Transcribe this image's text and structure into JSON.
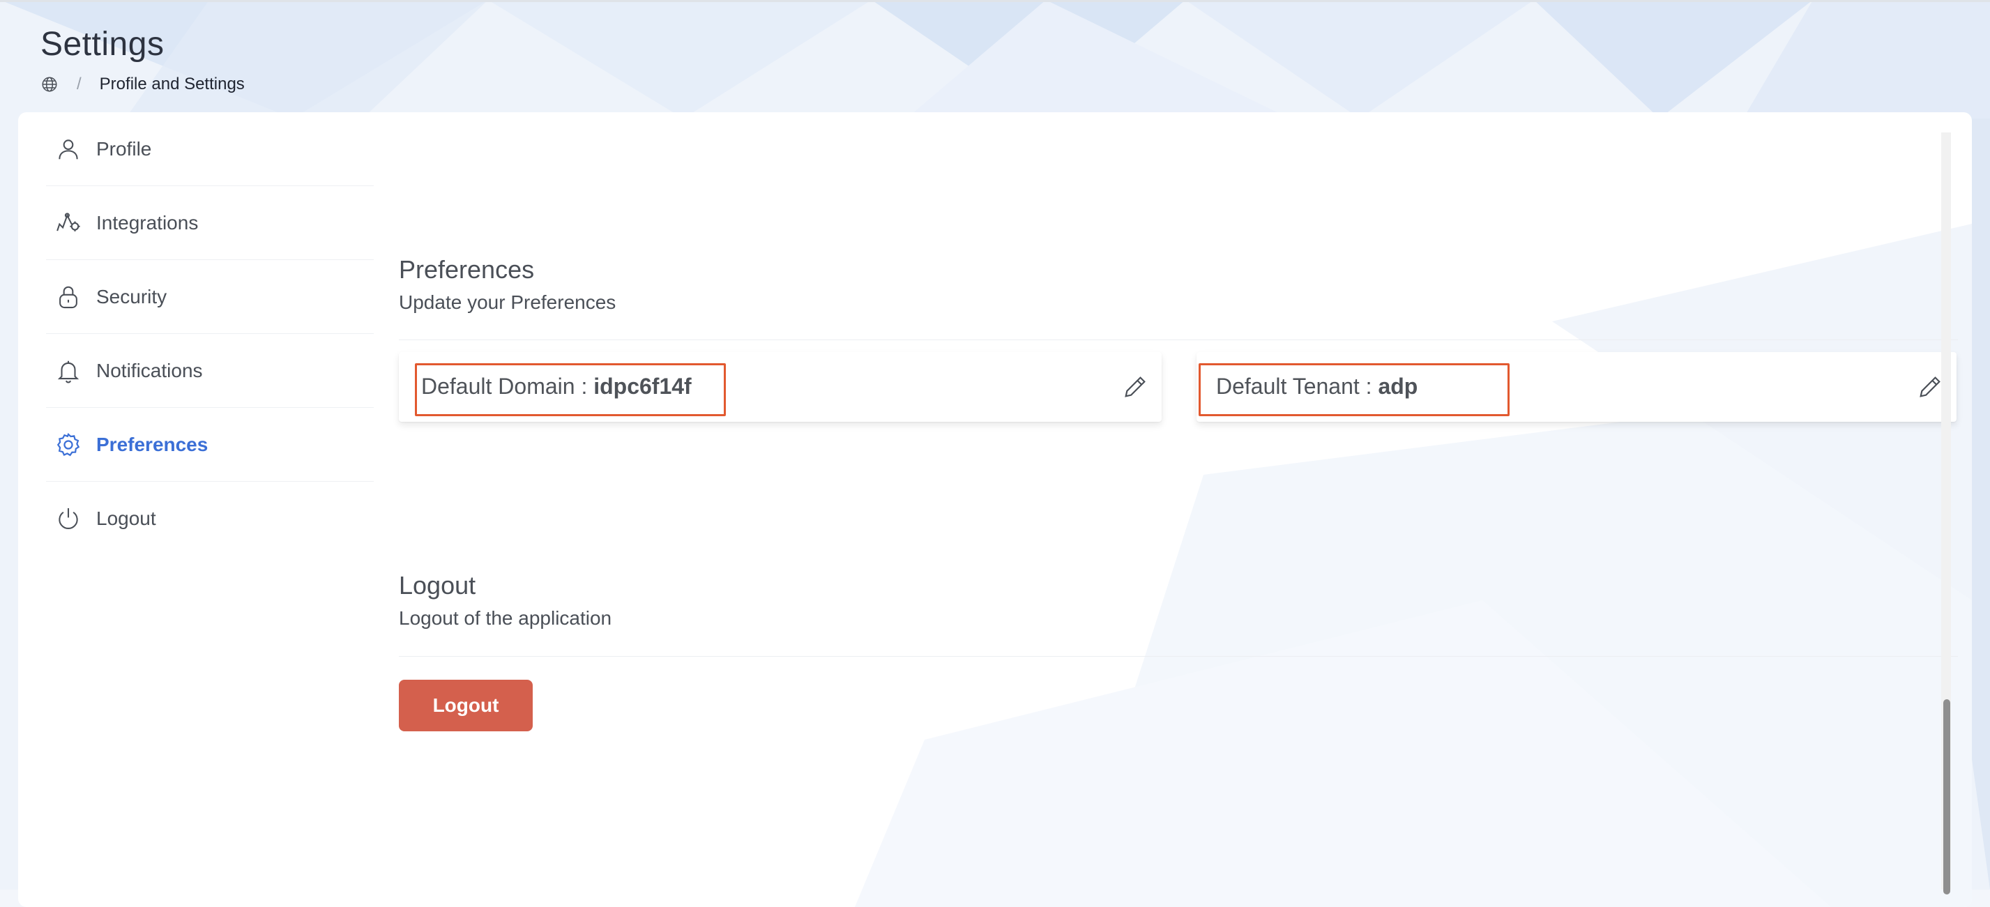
{
  "page": {
    "title": "Settings"
  },
  "breadcrumb": {
    "icon": "globe-icon",
    "separator": "/",
    "current": "Profile and Settings"
  },
  "sidebar": {
    "items": [
      {
        "label": "Profile",
        "icon": "user-icon",
        "active": false
      },
      {
        "label": "Integrations",
        "icon": "integrations-icon",
        "active": false
      },
      {
        "label": "Security",
        "icon": "lock-icon",
        "active": false
      },
      {
        "label": "Notifications",
        "icon": "bell-icon",
        "active": false
      },
      {
        "label": "Preferences",
        "icon": "gear-icon",
        "active": true
      },
      {
        "label": "Logout",
        "icon": "power-icon",
        "active": false
      }
    ]
  },
  "preferences": {
    "title": "Preferences",
    "subtitle": "Update your Preferences",
    "domain": {
      "label": "Default Domain : ",
      "value": "idpc6f14f"
    },
    "tenant": {
      "label": "Default Tenant : ",
      "value": "adp"
    }
  },
  "logout": {
    "title": "Logout",
    "subtitle": "Logout of the application",
    "button_label": "Logout"
  },
  "colors": {
    "accent": "#3b6fd6",
    "danger": "#d4604d",
    "highlight": "#e2592f",
    "text": "#4a4f57"
  }
}
